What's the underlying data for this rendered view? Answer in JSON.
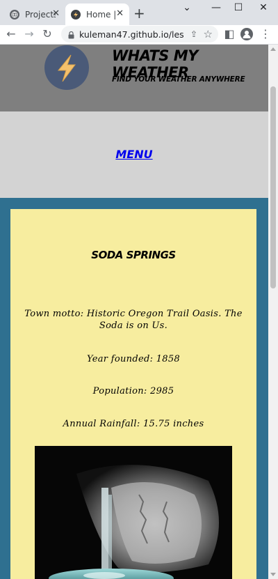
{
  "browser": {
    "tabs": [
      {
        "title": "Projects",
        "active": false
      },
      {
        "title": "Home | W",
        "active": true
      }
    ],
    "address": "kuleman47.github.io/lesson...",
    "accent": "#1a73e8"
  },
  "site": {
    "title": "WHATS MY WEATHER",
    "tagline": "FIND YOUR WEATHER ANYWHERE",
    "logo_icon": "lightning-bolt-icon",
    "header_color": "#7f7f7f",
    "nav_color": "#d3d3d3",
    "main_color": "#2f7090",
    "card_color": "#f7ed9f"
  },
  "nav": {
    "menu_label": "MENU"
  },
  "town": {
    "name": "SODA SPRINGS",
    "motto": "Town motto: Historic Oregon Trail Oasis. The Soda is on Us.",
    "founded": "Year founded: 1858",
    "population": "Population: 2985",
    "rainfall": "Annual Rainfall: 15.75 inches",
    "photo_subject": "waterfall-cave-photo"
  }
}
